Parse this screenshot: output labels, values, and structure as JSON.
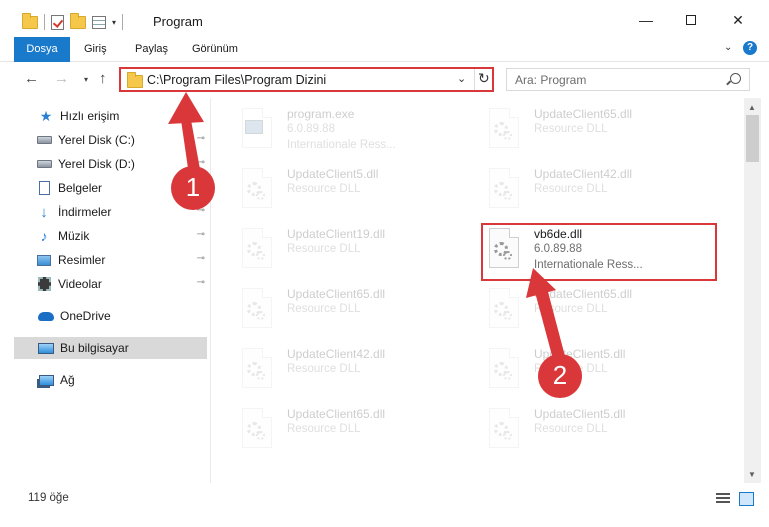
{
  "window": {
    "title": "Program",
    "minimize_glyph": "—",
    "close_glyph": "✕"
  },
  "ribbon": {
    "tabs": [
      "Dosya",
      "Giriş",
      "Paylaş",
      "Görünüm"
    ],
    "expand_glyph": "⌄",
    "help_glyph": "?"
  },
  "navigation": {
    "back_glyph": "←",
    "forward_glyph": "→",
    "recent_glyph": "▾",
    "up_glyph": "↑",
    "address": "C:\\Program Files\\Program Dizini",
    "address_dropdown_glyph": "⌄",
    "refresh_glyph": "↻",
    "search_placeholder": "Ara: Program"
  },
  "sidebar": {
    "items": [
      {
        "label": "Hızlı erişim",
        "icon": "star-icon",
        "pinned": false
      },
      {
        "label": "Yerel Disk (C:)",
        "icon": "disk-icon",
        "pinned": true
      },
      {
        "label": "Yerel Disk (D:)",
        "icon": "disk-icon",
        "pinned": true
      },
      {
        "label": "Belgeler",
        "icon": "document-icon",
        "pinned": true
      },
      {
        "label": "İndirmeler",
        "icon": "download-icon",
        "pinned": true
      },
      {
        "label": "Müzik",
        "icon": "music-icon",
        "pinned": true
      },
      {
        "label": "Resimler",
        "icon": "pictures-icon",
        "pinned": true
      },
      {
        "label": "Videolar",
        "icon": "video-icon",
        "pinned": true
      },
      {
        "label": "OneDrive",
        "icon": "cloud-icon",
        "pinned": false
      },
      {
        "label": "Bu bilgisayar",
        "icon": "computer-icon",
        "pinned": false,
        "selected": true
      },
      {
        "label": "Ağ",
        "icon": "network-icon",
        "pinned": false
      }
    ],
    "pin_glyph": "📌"
  },
  "files": [
    {
      "name": "program.exe",
      "line1": "6.0.89.88",
      "line2": "Internationale Ress...",
      "faded": true
    },
    {
      "name": "UpdateClient65.dll",
      "line1": "Resource DLL",
      "line2": "",
      "faded": true
    },
    {
      "name": "UpdateClient5.dll",
      "line1": "Resource DLL",
      "line2": "",
      "faded": true
    },
    {
      "name": "UpdateClient42.dll",
      "line1": "Resource DLL",
      "line2": "",
      "faded": true
    },
    {
      "name": "UpdateClient19.dll",
      "line1": "Resource DLL",
      "line2": "",
      "faded": true
    },
    {
      "name": "vb6de.dll",
      "line1": "6.0.89.88",
      "line2": "Internationale Ress...",
      "faded": false
    },
    {
      "name": "UpdateClient65.dll",
      "line1": "Resource DLL",
      "line2": "",
      "faded": true
    },
    {
      "name": "UpdateClient65.dll",
      "line1": "Resource DLL",
      "line2": "",
      "faded": true
    },
    {
      "name": "UpdateClient42.dll",
      "line1": "Resource DLL",
      "line2": "",
      "faded": true
    },
    {
      "name": "UpdateClient5.dll",
      "line1": "Resource DLL",
      "line2": "",
      "faded": true
    },
    {
      "name": "UpdateClient65.dll",
      "line1": "Resource DLL",
      "line2": "",
      "faded": true
    },
    {
      "name": "UpdateClient5.dll",
      "line1": "Resource DLL",
      "line2": "",
      "faded": true
    }
  ],
  "status": {
    "item_count": "119 öğe"
  },
  "annotations": {
    "step1": "1",
    "step2": "2",
    "color": "#d9373a"
  },
  "colors": {
    "accent": "#1979ca",
    "highlight": "#d9373a",
    "selected_nav": "#d9d9d9"
  }
}
